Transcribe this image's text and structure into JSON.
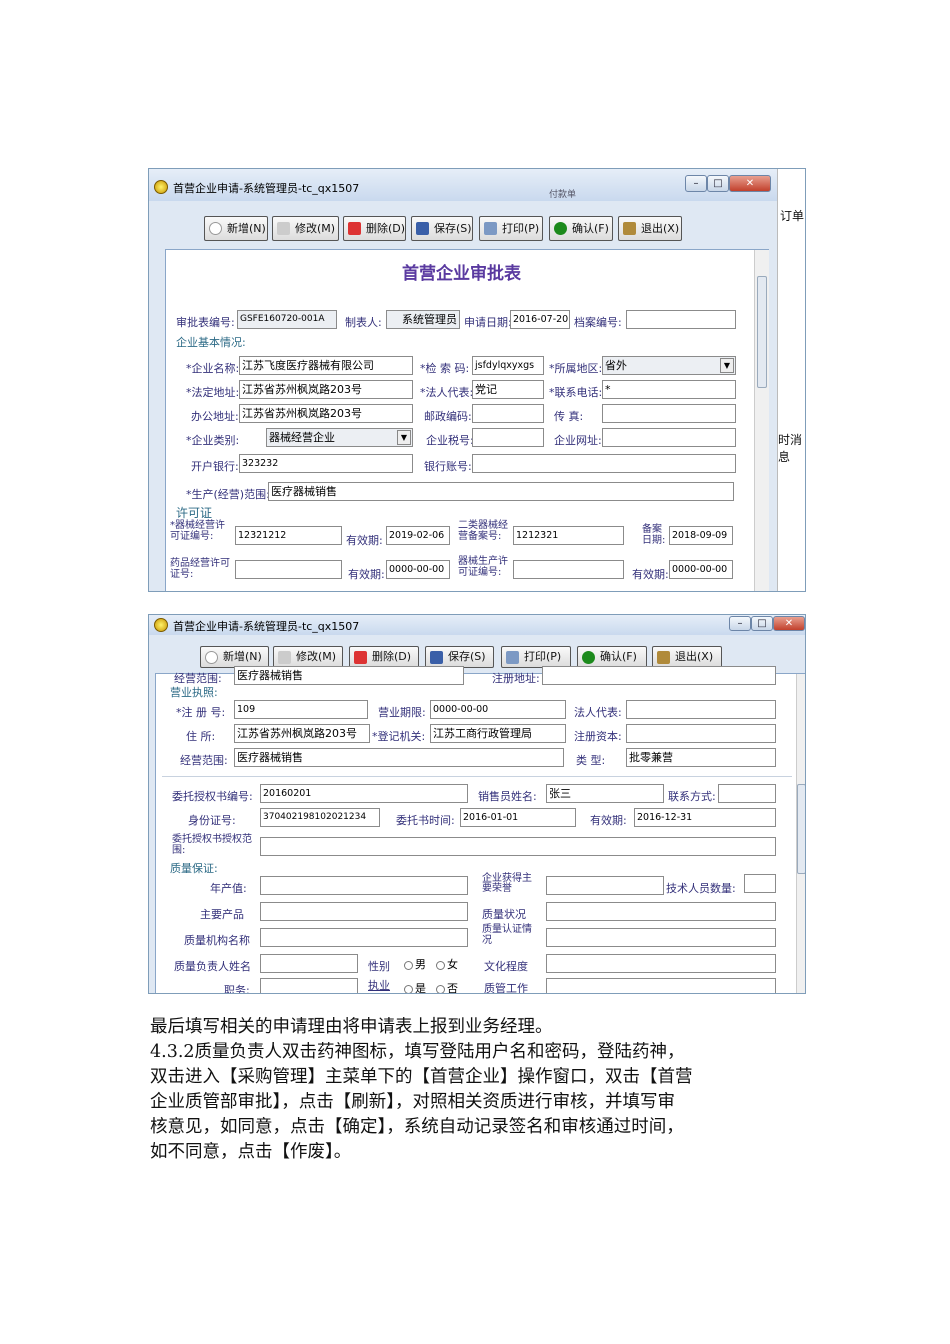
{
  "window1": {
    "title": "首营企业申请-系统管理员-tc_qx1507",
    "bg_hint": "付款单",
    "side_text_1": "订单",
    "side_text_2": "时消息",
    "toolbar": [
      "新增(N)",
      "修改(M)",
      "删除(D)",
      "保存(S)",
      "打印(P)",
      "确认(F)",
      "退出(X)"
    ],
    "form_title": "首营企业审批表",
    "header": {
      "approval_no_label": "审批表编号:",
      "approval_no": "GSFE160720-001A",
      "maker_label": "制表人:",
      "maker": "系统管理员",
      "apply_date_label": "申请日期:",
      "apply_date": "2016-07-20",
      "archive_no_label": "档案编号:",
      "archive_no": ""
    },
    "basic_section": "企业基本情况:",
    "basic": {
      "name_label": "*企业名称:",
      "name": "江苏飞度医疗器械有限公司",
      "search_code_label": "*检 索 码:",
      "search_code": "jsfdylqxyxgs",
      "region_label": "*所属地区:",
      "region": "省外",
      "legal_addr_label": "*法定地址:",
      "legal_addr": "江苏省苏州枫岚路203号",
      "legal_rep_label": "*法人代表:",
      "legal_rep": "党记",
      "phone_label": "*联系电话:",
      "phone": "*",
      "office_addr_label": "办公地址:",
      "office_addr": "江苏省苏州枫岚路203号",
      "postcode_label": "邮政编码:",
      "postcode": "",
      "fax_label": "传    真:",
      "fax": "",
      "type_label": "*企业类别:",
      "type": "器械经营企业",
      "tax_label": "企业税号:",
      "tax": "",
      "website_label": "企业网址:",
      "website": "",
      "bank_label": "开户银行:",
      "bank": "323232",
      "account_label": "银行账号:",
      "account": "",
      "scope_label": "*生产(经营)范围:",
      "scope": "医疗器械销售"
    },
    "license_section": "许可证",
    "license": {
      "dev_license_label": "*器械经营许可证编号:",
      "dev_license": "12321212",
      "valid1_label": "有效期:",
      "valid1": "2019-02-06",
      "class2_label": "二类器械经营备案号:",
      "class2": "1212321",
      "record_date_label": "备案日期:",
      "record_date": "2018-09-09",
      "drug_license_label": "药品经营许可证号:",
      "drug_license": "",
      "valid2_label": "有效期:",
      "valid2": "0000-00-00",
      "dev_prod_label": "器械生产许可证编号:",
      "dev_prod": "",
      "valid3_label": "有效期:",
      "valid3": "0000-00-00"
    }
  },
  "window2": {
    "title": "首营企业申请-系统管理员-tc_qx1507",
    "toolbar": [
      "新增(N)",
      "修改(M)",
      "删除(D)",
      "保存(S)",
      "打印(P)",
      "确认(F)",
      "退出(X)"
    ],
    "partial_top": {
      "scope_label": "经营范围:",
      "scope": "医疗器械销售",
      "reg_addr_label": "注册地址:"
    },
    "biz_section": "营业执照:",
    "biz": {
      "reg_no_label": "*注 册 号:",
      "reg_no": "109",
      "period_label": "营业期限:",
      "period": "0000-00-00",
      "legal_label": "法人代表:",
      "legal": "",
      "addr_label": "住    所:",
      "addr": "江苏省苏州枫岚路203号",
      "authority_label": "*登记机关:",
      "authority": "江苏工商行政管理局",
      "capital_label": "注册资本:",
      "capital": "",
      "scope_label": "经营范围:",
      "scope": "医疗器械销售",
      "kind_label": "类    型:",
      "kind": "批零兼营"
    },
    "auth": {
      "auth_no_label": "委托授权书编号:",
      "auth_no": "20160201",
      "seller_label": "销售员姓名:",
      "seller": "张三",
      "contact_label": "联系方式:",
      "contact": "",
      "id_label": "身份证号:",
      "id": "370402198102021234",
      "auth_time_label": "委托书时间:",
      "auth_time": "2016-01-01",
      "valid_label": "有效期:",
      "valid": "2016-12-31",
      "auth_scope_label": "委托授权书授权范围:",
      "auth_scope": ""
    },
    "quality_section": "质量保证:",
    "quality": {
      "output_label": "年产值:",
      "main_biz_label": "企业获得主要荣誉",
      "tech_count_label": "技术人员数量:",
      "product_label": "主要产品",
      "q_status_label": "质量状况",
      "q_org_label": "质量机构名称",
      "q_cert_label": "质量认证情况",
      "q_person_label": "质量负责人姓名",
      "gender_label": "性别",
      "male": "男",
      "female": "女",
      "edu_label": "文化程度",
      "duty_label": "职务:",
      "cert_label": "执业",
      "yes": "是",
      "no": "否",
      "q_work_label": "质管工作"
    }
  },
  "paragraph": [
    "最后填写相关的申请理由将申请表上报到业务经理。",
    "4.3.2质量负责人双击药神图标，填写登陆用户名和密码，登陆药神，",
    "双击进入【采购管理】主菜单下的【首营企业】操作窗口，双击【首营",
    "企业质管部审批】，点击【刷新】，对照相关资质进行审核，并填写审",
    "核意见，如同意，点击【确定】，系统自动记录签名和审核通过时间，",
    "如不同意，点击【作废】。"
  ]
}
